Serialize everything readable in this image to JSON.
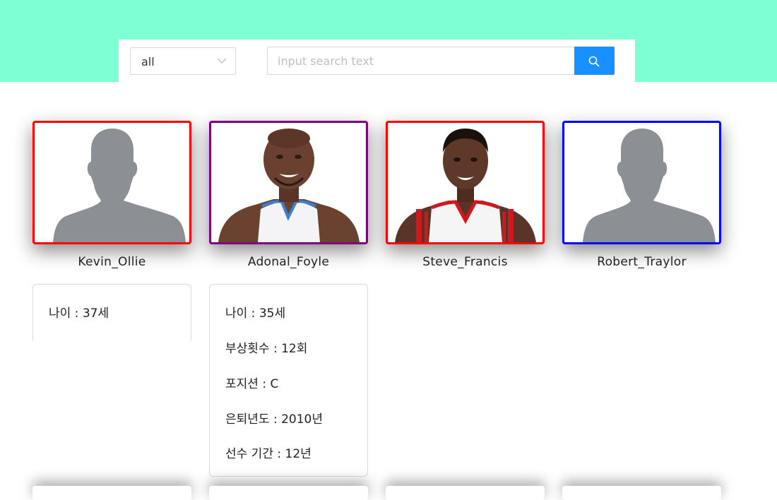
{
  "search": {
    "filter_value": "all",
    "placeholder": "input search text"
  },
  "colors": {
    "top_band": "#7fffd4",
    "search_button": "#1890ff",
    "border_red": "#ff0000",
    "border_purple": "#800080",
    "border_blue": "#0000ff"
  },
  "players": [
    {
      "name": "Kevin_Ollie",
      "photo": "placeholder-silhouette",
      "border": "#ff0000"
    },
    {
      "name": "Adonal_Foyle",
      "photo": "player-photo",
      "border": "#800080"
    },
    {
      "name": "Steve_Francis",
      "photo": "player-photo",
      "border": "#ff0000"
    },
    {
      "name": "Robert_Traylor",
      "photo": "placeholder-silhouette",
      "border": "#0000ff"
    }
  ],
  "details": {
    "kevin": {
      "age": "나이 : 37세"
    },
    "adonal": {
      "age": "나이 : 35세",
      "injuries": "부상횟수 : 12회",
      "position": "포지션 : C",
      "retire": "은퇴년도 : 2010년",
      "career": "선수 기간 : 12년"
    }
  }
}
